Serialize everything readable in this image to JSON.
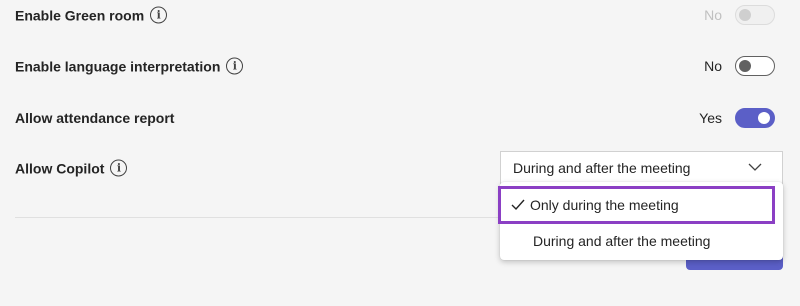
{
  "settings": {
    "green_room": {
      "label": "Enable Green room",
      "state_text": "No",
      "state": "off",
      "disabled": true
    },
    "language_interpretation": {
      "label": "Enable language interpretation",
      "state_text": "No",
      "state": "off",
      "disabled": false
    },
    "attendance_report": {
      "label": "Allow attendance report",
      "state_text": "Yes",
      "state": "on",
      "disabled": false
    },
    "copilot": {
      "label": "Allow Copilot",
      "selected_value": "During and after the meeting",
      "options": [
        {
          "label": "Only during the meeting",
          "checked": true,
          "highlighted": true
        },
        {
          "label": "During and after the meeting",
          "checked": false,
          "highlighted": false
        }
      ]
    }
  },
  "icons": {
    "info": "info-icon",
    "chevron": "chevron-down-icon",
    "check": "checkmark-icon"
  },
  "colors": {
    "accent": "#5b5fc7",
    "highlight_border": "#8b3fc4",
    "background": "#f5f5f5"
  }
}
